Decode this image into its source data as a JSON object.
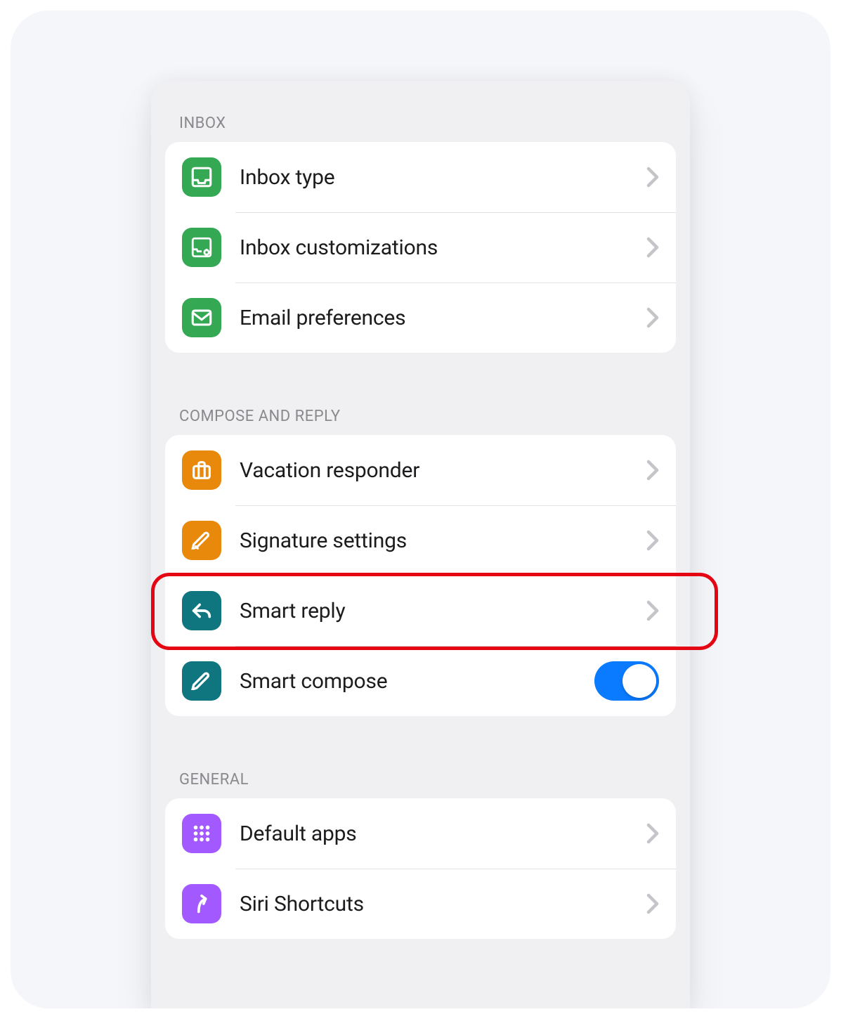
{
  "sections": {
    "inbox": {
      "header": "INBOX",
      "items": [
        {
          "label": "Inbox type"
        },
        {
          "label": "Inbox customizations"
        },
        {
          "label": "Email preferences"
        }
      ]
    },
    "compose": {
      "header": "COMPOSE AND REPLY",
      "items": [
        {
          "label": "Vacation responder"
        },
        {
          "label": "Signature settings"
        },
        {
          "label": "Smart reply"
        },
        {
          "label": "Smart compose",
          "toggle": true
        }
      ]
    },
    "general": {
      "header": "GENERAL",
      "items": [
        {
          "label": "Default apps"
        },
        {
          "label": "Siri Shortcuts"
        }
      ]
    }
  },
  "highlighted": "signature-settings"
}
